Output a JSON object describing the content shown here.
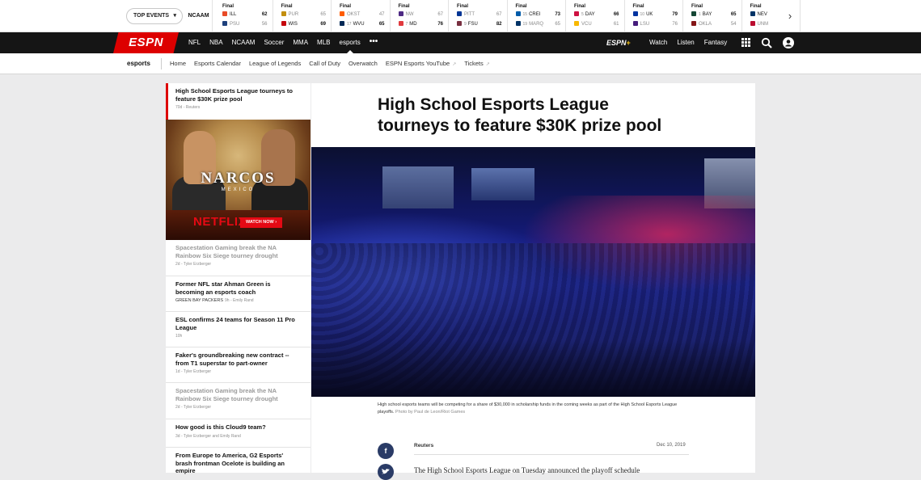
{
  "scoreboard": {
    "top_events_label": "TOP EVENTS",
    "league": "NCAAM",
    "games": [
      {
        "status": "Final",
        "away": {
          "name": "ILL",
          "score": "62",
          "rank": "",
          "color": "#e84a27",
          "winner": true
        },
        "home": {
          "name": "PSU",
          "score": "56",
          "rank": "",
          "color": "#1e407c",
          "winner": false
        }
      },
      {
        "status": "Final",
        "away": {
          "name": "PUR",
          "score": "65",
          "rank": "",
          "color": "#c28e0e",
          "winner": false
        },
        "home": {
          "name": "WIS",
          "score": "69",
          "rank": "",
          "color": "#c5050c",
          "winner": true
        }
      },
      {
        "status": "Final",
        "away": {
          "name": "OKST",
          "score": "47",
          "rank": "",
          "color": "#fe5c00",
          "winner": false
        },
        "home": {
          "name": "WVU",
          "score": "65",
          "rank": "17",
          "color": "#002855",
          "winner": true
        }
      },
      {
        "status": "Final",
        "away": {
          "name": "NW",
          "score": "67",
          "rank": "",
          "color": "#4e2a84",
          "winner": false
        },
        "home": {
          "name": "MD",
          "score": "76",
          "rank": "7",
          "color": "#e03a3e",
          "winner": true
        }
      },
      {
        "status": "Final",
        "away": {
          "name": "PITT",
          "score": "67",
          "rank": "",
          "color": "#003594",
          "winner": false
        },
        "home": {
          "name": "FSU",
          "score": "82",
          "rank": "9",
          "color": "#782f40",
          "winner": true
        }
      },
      {
        "status": "Final",
        "away": {
          "name": "CREI",
          "score": "73",
          "rank": "15",
          "color": "#005ca9",
          "winner": true
        },
        "home": {
          "name": "MARQ",
          "score": "65",
          "rank": "19",
          "color": "#003366",
          "winner": false
        }
      },
      {
        "status": "Final",
        "away": {
          "name": "DAY",
          "score": "66",
          "rank": "5",
          "color": "#ce1141",
          "winner": true
        },
        "home": {
          "name": "VCU",
          "score": "61",
          "rank": "",
          "color": "#f8b800",
          "winner": false
        }
      },
      {
        "status": "Final",
        "away": {
          "name": "UK",
          "score": "79",
          "rank": "10",
          "color": "#0033a0",
          "winner": true
        },
        "home": {
          "name": "LSU",
          "score": "76",
          "rank": "",
          "color": "#461d7c",
          "winner": false
        }
      },
      {
        "status": "Final",
        "away": {
          "name": "BAY",
          "score": "65",
          "rank": "1",
          "color": "#154734",
          "winner": true
        },
        "home": {
          "name": "OKLA",
          "score": "54",
          "rank": "",
          "color": "#841617",
          "winner": false
        }
      },
      {
        "status": "Final",
        "away": {
          "name": "NEV",
          "score": "",
          "rank": "",
          "color": "#003366",
          "winner": true
        },
        "home": {
          "name": "UNM",
          "score": "",
          "rank": "",
          "color": "#ba0c2f",
          "winner": false
        }
      }
    ]
  },
  "nav": {
    "logo": "ESPN",
    "links": [
      "NFL",
      "NBA",
      "NCAAM",
      "Soccer",
      "MMA",
      "MLB",
      "esports"
    ],
    "more": "•••",
    "plus_label": "ESPN",
    "plus_mark": "+",
    "right_links": [
      "Watch",
      "Listen",
      "Fantasy"
    ]
  },
  "subnav": {
    "brand": "esports",
    "links": [
      "Home",
      "Esports Calendar",
      "League of Legends",
      "Call of Duty",
      "Overwatch",
      "ESPN Esports YouTube",
      "Tickets"
    ],
    "external_icon": "↗"
  },
  "sidebar": {
    "items": [
      {
        "title": "High School Esports League tourneys to feature $30K prize pool",
        "meta": "70d - Reuters",
        "tag": ""
      },
      {
        "title": "Spacestation Gaming break the NA Rainbow Six Siege tourney drought",
        "meta": "2d - Tyler Erzberger",
        "tag": ""
      },
      {
        "title": "Former NFL star Ahman Green is becoming an esports coach",
        "meta": "9h - Emily Rand",
        "tag": "GREEN BAY PACKERS"
      },
      {
        "title": "ESL confirms 24 teams for Season 11 Pro League",
        "meta": "10h",
        "tag": ""
      },
      {
        "title": "Faker's groundbreaking new contract -- from T1 superstar to part-owner",
        "meta": "1d - Tyler Erzberger",
        "tag": ""
      },
      {
        "title": "Spacestation Gaming break the NA Rainbow Six Siege tourney drought",
        "meta": "2d - Tyler Erzberger",
        "tag": ""
      },
      {
        "title": "How good is this Cloud9 team?",
        "meta": "3d - Tyler Erzberger and Emily Rand",
        "tag": ""
      },
      {
        "title": "From Europe to America, G2 Esports' brash frontman Ocelote is building an empire",
        "meta": "",
        "tag": ""
      }
    ],
    "ad": {
      "title": "NARCOS",
      "subtitle": "MEXICO",
      "brand": "NETFLIX",
      "cta": "WATCH NOW ›"
    }
  },
  "article": {
    "headline": "High School Esports League tourneys to feature $30K prize pool",
    "caption": "High school esports teams will be competing for a share of $30,000 in scholarship funds in the coming weeks as part of the High School Esports League playoffs.",
    "credit": "Photo by Paul de Leon/Riot Games",
    "source": "Reuters",
    "date": "Dec 10, 2019",
    "body_start": "The High School Esports League on Tuesday announced the playoff schedule"
  }
}
